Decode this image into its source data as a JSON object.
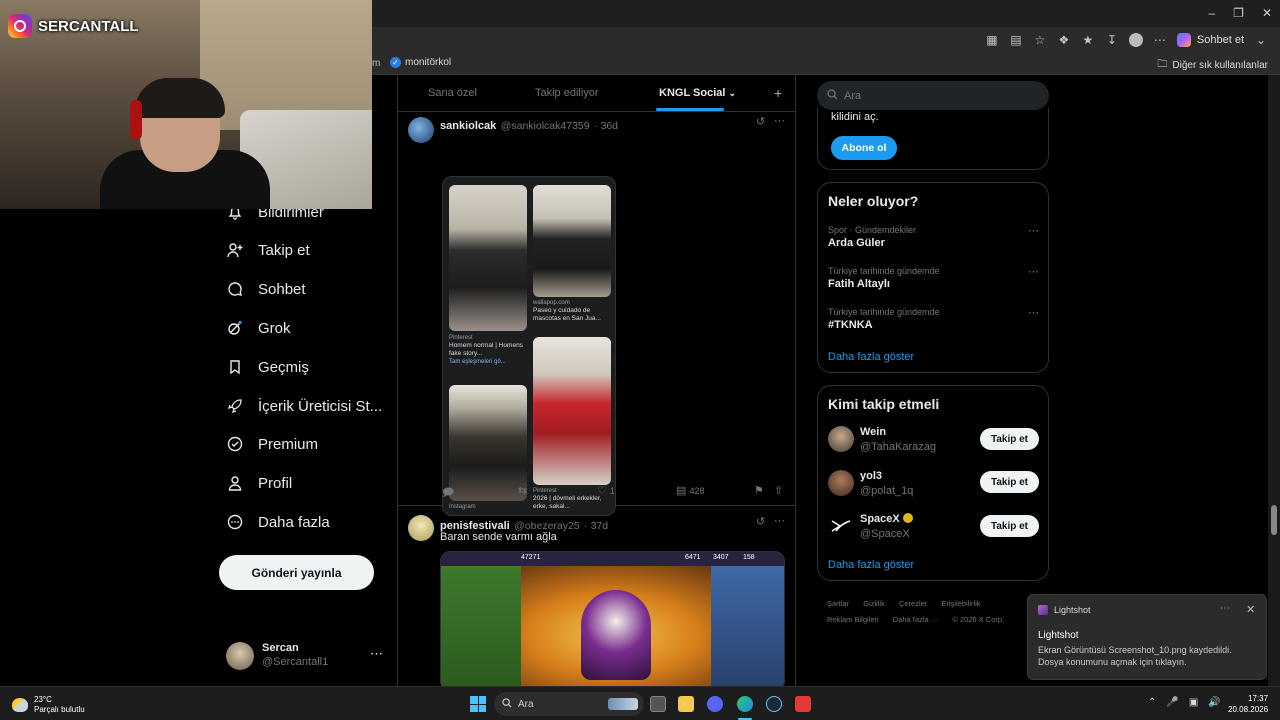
{
  "overlay": {
    "instagram_handle": "SERCANTALL"
  },
  "browser": {
    "sohbet_label": "Sohbet et",
    "bookmark_left": "m",
    "bookmark_item": "monitörkol",
    "bookmark_right": "Diğer sık kullanılanlar"
  },
  "nav": {
    "items": [
      {
        "label": "Bildirimler",
        "icon": "bell-icon"
      },
      {
        "label": "Takip et",
        "icon": "person-add-icon"
      },
      {
        "label": "Sohbet",
        "icon": "chat-icon"
      },
      {
        "label": "Grok",
        "icon": "grok-icon"
      },
      {
        "label": "Geçmiş",
        "icon": "bookmark-icon"
      },
      {
        "label": "İçerik Üreticisi St...",
        "icon": "rocket-icon"
      },
      {
        "label": "Premium",
        "icon": "verified-icon"
      },
      {
        "label": "Profil",
        "icon": "profile-icon"
      },
      {
        "label": "Daha fazla",
        "icon": "more-circle-icon"
      }
    ],
    "post_button": "Gönderi yayınla",
    "account": {
      "name": "Sercan",
      "handle": "@Sercantall1"
    }
  },
  "tabs": {
    "items": [
      "Sana özel",
      "Takip ediliyor",
      "KNGL Social"
    ],
    "active": "KNGL Social"
  },
  "tweets": [
    {
      "name": "sankiolcak",
      "handle": "@sankiolcak47359",
      "time": "· 36d",
      "text": "",
      "collage": {
        "source_1": "wallapop.com",
        "caption_1": "Paseo y cuidado de mascotas en San Jua...",
        "source_2": "Pinterest",
        "caption_2": "Homem normal | Homens fake story...",
        "link_2": "Tam eşleşmeleri gö...",
        "source_3": "Instagram",
        "source_4": "Pinterest",
        "caption_4": "2026 | dövmeli erkekler, erke, sakal..."
      },
      "actions": {
        "replies": "",
        "reposts": "",
        "likes": "1",
        "views": "428"
      }
    },
    {
      "name": "penisfestivali",
      "handle": "@obezeray25",
      "time": "· 37d",
      "text": "Baran sende varmı ağla",
      "game_stats": [
        "47271",
        "6471",
        "3407",
        "158"
      ]
    }
  ],
  "sidebar": {
    "search_placeholder": "Ara",
    "premium_text": "kilidini aç.",
    "subscribe_button": "Abone ol",
    "trends_title": "Neler oluyor?",
    "trends": [
      {
        "context": "Spor · Gündemdekiler",
        "name": "Arda Güler"
      },
      {
        "context": "Türkiye tarihinde gündemde",
        "name": "Fatih Altaylı"
      },
      {
        "context": "Türkiye tarihinde gündemde",
        "name": "#TKNKA"
      }
    ],
    "show_more": "Daha fazla göster",
    "wtf_title": "Kimi takip etmeli",
    "wtf": [
      {
        "name": "Wein",
        "handle": "@TahaKarazag"
      },
      {
        "name": "yol3",
        "handle": "@polat_1q"
      },
      {
        "name": "SpaceX",
        "handle": "@SpaceX"
      }
    ],
    "follow_label": "Takip et",
    "footer": [
      "Şartlar",
      "Gizlilik",
      "Çerezler",
      "Erişilebilirlik",
      "Reklam Bilgileri",
      "Daha fazla ···",
      "© 2026 X Corp."
    ]
  },
  "toast": {
    "app": "Lightshot",
    "title": "Lightshot",
    "body_1": "Ekran Görüntüsü Screenshot_10.png kaydedildi.",
    "body_2": "Dosya konumunu açmak için tıklayın."
  },
  "taskbar": {
    "temp": "23°C",
    "weather": "Parçalı bulutlu",
    "search": "Ara",
    "time": "17:37",
    "date": "20.08.2026"
  }
}
